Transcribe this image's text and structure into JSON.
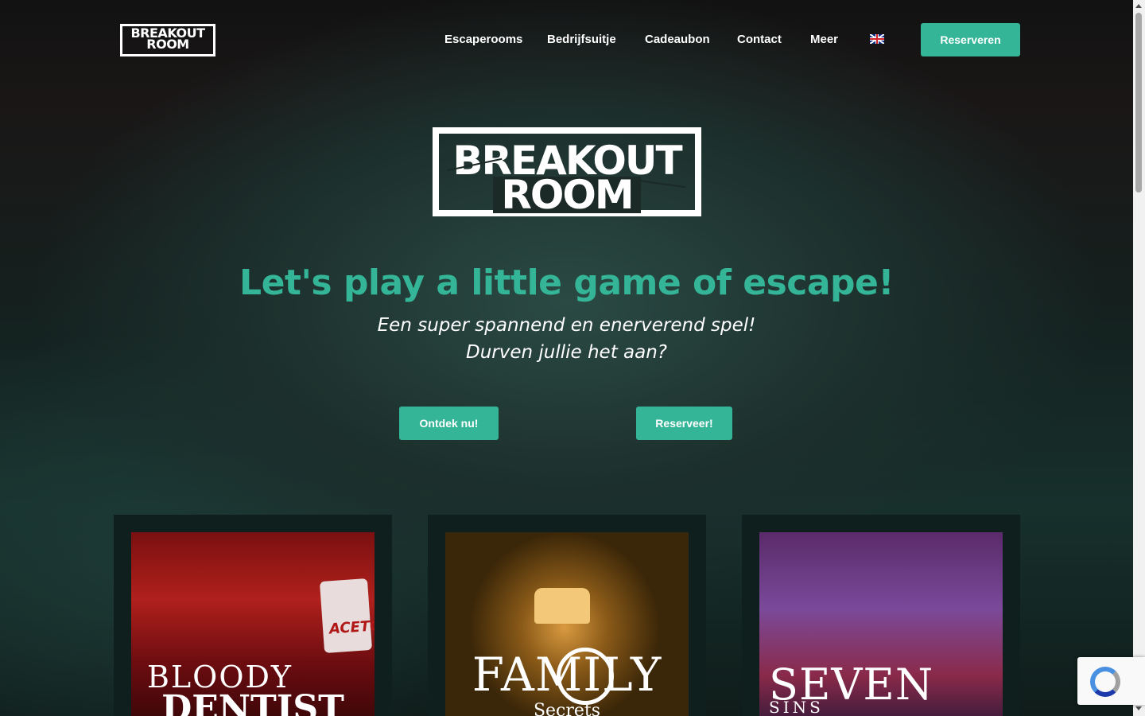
{
  "header": {
    "logo_line1": "BREAKOUT",
    "logo_line2": "ROOM",
    "nav": [
      {
        "label": "Escaperooms"
      },
      {
        "label": "Bedrijfsuitje"
      },
      {
        "label": "Cadeaubon"
      },
      {
        "label": "Contact"
      },
      {
        "label": "Meer"
      }
    ],
    "language_icon": "uk-flag-icon",
    "cta_label": "Reserveren"
  },
  "hero": {
    "logo_line1": "BREAKOUT",
    "logo_line2": "ROOM",
    "headline": "Let's play a little game of escape!",
    "subline1": "Een super spannend en enerverend spel!",
    "subline2": "Durven jullie het aan?",
    "discover_label": "Ontdek nu!",
    "book_label": "Reserveer!"
  },
  "rooms": [
    {
      "title1": "BLOODY",
      "title2": "DENTIST",
      "label_text": "ACETO"
    },
    {
      "title1": "FAMILY",
      "title2": "Secrets"
    },
    {
      "title1": "SEVEN",
      "title2": "SINS"
    }
  ],
  "colors": {
    "accent": "#35b597",
    "text": "#ffffff"
  },
  "widgets": {
    "recaptcha_icon": "recaptcha-icon"
  }
}
